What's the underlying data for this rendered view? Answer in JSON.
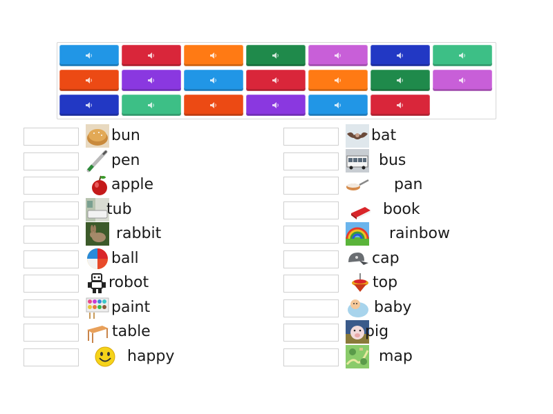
{
  "tiles": [
    {
      "color": "#2196e6",
      "icon": "speaker-icon"
    },
    {
      "color": "#d9263a",
      "icon": "speaker-icon"
    },
    {
      "color": "#ff7a14",
      "icon": "speaker-icon"
    },
    {
      "color": "#1f8a4b",
      "icon": "speaker-icon"
    },
    {
      "color": "#c85fd8",
      "icon": "speaker-icon"
    },
    {
      "color": "#2238c4",
      "icon": "speaker-icon"
    },
    {
      "color": "#3dbf86",
      "icon": "speaker-icon"
    },
    {
      "color": "#ec4a14",
      "icon": "speaker-icon"
    },
    {
      "color": "#8a38e0",
      "icon": "speaker-icon"
    },
    {
      "color": "#2196e6",
      "icon": "speaker-icon"
    },
    {
      "color": "#d9263a",
      "icon": "speaker-icon"
    },
    {
      "color": "#ff7a14",
      "icon": "speaker-icon"
    },
    {
      "color": "#1f8a4b",
      "icon": "speaker-icon"
    },
    {
      "color": "#c85fd8",
      "icon": "speaker-icon"
    },
    {
      "color": "#2238c4",
      "icon": "speaker-icon"
    },
    {
      "color": "#3dbf86",
      "icon": "speaker-icon"
    },
    {
      "color": "#ec4a14",
      "icon": "speaker-icon"
    },
    {
      "color": "#8a38e0",
      "icon": "speaker-icon"
    },
    {
      "color": "#2196e6",
      "icon": "speaker-icon"
    },
    {
      "color": "#d9263a",
      "icon": "speaker-icon"
    }
  ],
  "left_items": [
    {
      "word": "bun",
      "icon": "bun-icon"
    },
    {
      "word": "pen",
      "icon": "pen-icon"
    },
    {
      "word": "apple",
      "icon": "apple-icon"
    },
    {
      "word": "tub",
      "icon": "tub-icon"
    },
    {
      "word": "rabbit",
      "icon": "rabbit-icon"
    },
    {
      "word": "ball",
      "icon": "ball-icon"
    },
    {
      "word": "robot",
      "icon": "robot-icon"
    },
    {
      "word": "paint",
      "icon": "paint-icon"
    },
    {
      "word": "table",
      "icon": "table-icon"
    },
    {
      "word": "happy",
      "icon": "smiley-icon"
    }
  ],
  "right_items": [
    {
      "word": "bat",
      "icon": "bat-icon"
    },
    {
      "word": "bus",
      "icon": "bus-icon"
    },
    {
      "word": "pan",
      "icon": "pan-icon"
    },
    {
      "word": "book",
      "icon": "book-icon"
    },
    {
      "word": "rainbow",
      "icon": "rainbow-icon"
    },
    {
      "word": "cap",
      "icon": "cap-icon"
    },
    {
      "word": "top",
      "icon": "top-icon"
    },
    {
      "word": "baby",
      "icon": "baby-icon"
    },
    {
      "word": "pig",
      "icon": "pig-icon"
    },
    {
      "word": "map",
      "icon": "map-icon"
    }
  ]
}
